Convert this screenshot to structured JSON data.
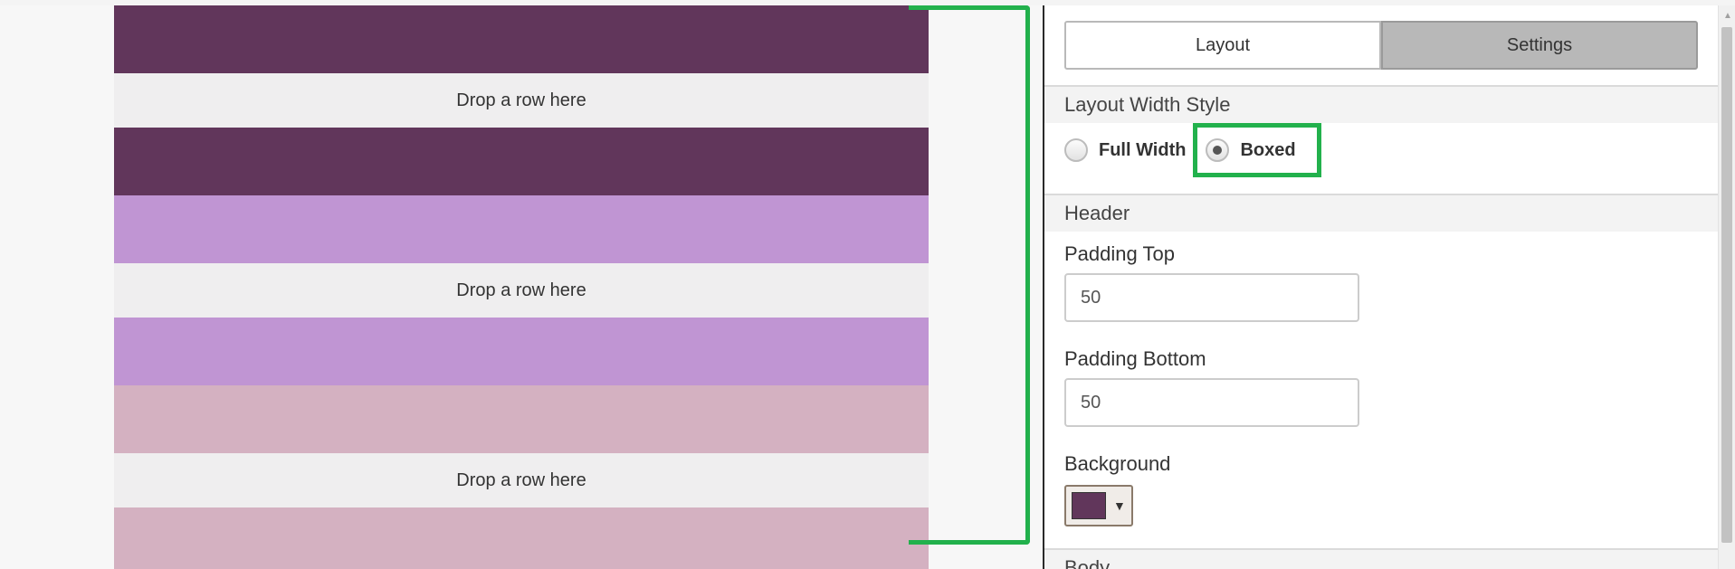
{
  "canvas": {
    "dropzone_text": "Drop a row here",
    "bands": [
      {
        "kind": "band",
        "color": "#61365b"
      },
      {
        "kind": "drop"
      },
      {
        "kind": "band",
        "color": "#61365b"
      },
      {
        "kind": "band",
        "color": "#c095d3"
      },
      {
        "kind": "drop"
      },
      {
        "kind": "band",
        "color": "#c095d3"
      },
      {
        "kind": "band",
        "color": "#d4b1c1"
      },
      {
        "kind": "drop"
      },
      {
        "kind": "band",
        "color": "#d4b1c1"
      }
    ]
  },
  "panel": {
    "tabs": [
      "Layout",
      "Settings"
    ],
    "layout_width_style": {
      "title": "Layout Width Style",
      "options": [
        "Full Width",
        "Boxed"
      ],
      "selected": "Boxed"
    },
    "header": {
      "title": "Header",
      "padding_top_label": "Padding Top",
      "padding_top_value": "50",
      "padding_bottom_label": "Padding Bottom",
      "padding_bottom_value": "50",
      "background_label": "Background",
      "background_color": "#61365b"
    },
    "body": {
      "title": "Body"
    }
  },
  "annotation_color": "#22b14c"
}
